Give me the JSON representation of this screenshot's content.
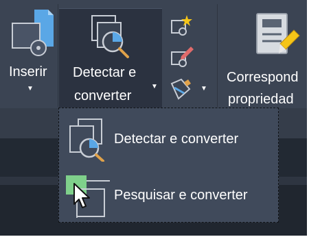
{
  "ribbon": {
    "insert": {
      "label": "Inserir"
    },
    "detect_convert": {
      "line1": "Detectar e",
      "line2": "converter"
    },
    "match_properties": {
      "line1": "Correspond",
      "line2": "propriedad"
    }
  },
  "dropdown": {
    "items": [
      {
        "label": "Detectar e converter"
      },
      {
        "label": "Pesquisar e converter"
      }
    ]
  },
  "colors": {
    "ribbon_bg": "#3b4453",
    "active_bg": "#2b3240",
    "menu_bg": "#404a5b",
    "accent_blue": "#5aa7e6",
    "accent_green": "#7fd08b",
    "spark_yellow": "#f5c518"
  },
  "icons": [
    "insert-block-icon",
    "detect-convert-icon",
    "new-block-icon",
    "edit-block-icon",
    "block-tools-icon",
    "match-properties-icon",
    "search-convert-icon",
    "mouse-cursor-icon"
  ]
}
